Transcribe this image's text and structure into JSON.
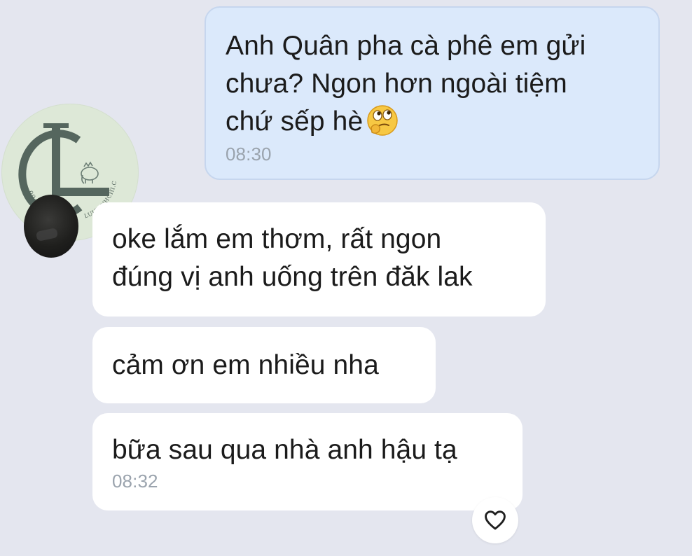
{
  "messages": [
    {
      "direction": "outgoing",
      "text": "Anh Quân pha cà phê em gửi\nchưa? Ngon hơn ngoài tiệm\nchứ sếp hè",
      "emoji": "thinking-face-icon",
      "time": "08:30"
    },
    {
      "direction": "incoming",
      "text": "oke lắm em thơm, rất ngon\nđúng vị anh uống trên đăk lak"
    },
    {
      "direction": "incoming",
      "text": "cảm ơn em nhiều nha"
    },
    {
      "direction": "incoming",
      "text": "bữa sau qua nhà anh hậu tạ",
      "time": "08:32"
    }
  ],
  "watermark": {
    "monogram": "LC",
    "phone": "0943 506 310",
    "site": "LUULINHCHI.COM"
  },
  "reaction": {
    "icon": "heart-outline-icon"
  },
  "colors": {
    "background": "#e4e6ef",
    "outgoing_bubble": "#dbe9fb",
    "incoming_bubble": "#ffffff",
    "timestamp": "#9aa3ad",
    "watermark_bg": "#dde8d7",
    "watermark_ink": "#55665e"
  }
}
